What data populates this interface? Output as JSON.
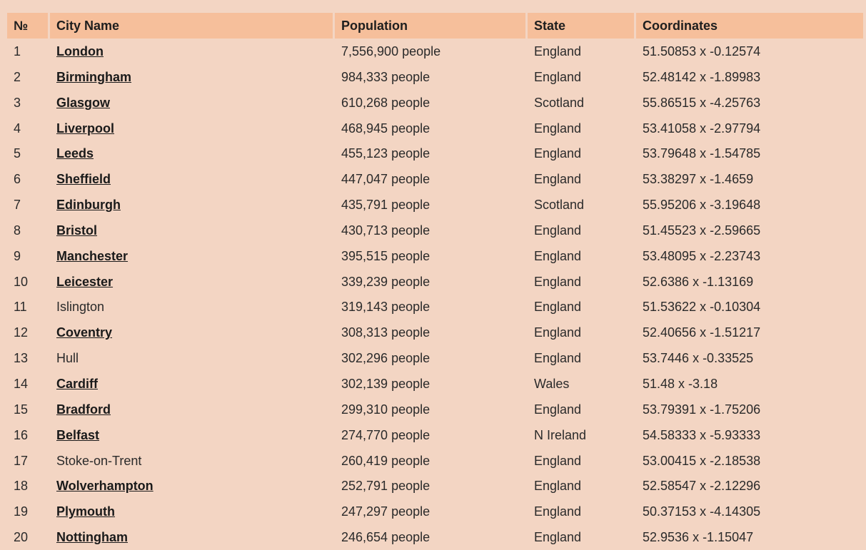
{
  "table": {
    "headers": {
      "num": "№",
      "city": "City Name",
      "population": "Population",
      "state": "State",
      "coordinates": "Coordinates"
    },
    "rows": [
      {
        "num": "1",
        "city": "London",
        "link": true,
        "population": "7,556,900 people",
        "state": "England",
        "coordinates": "51.50853 x -0.12574"
      },
      {
        "num": "2",
        "city": "Birmingham",
        "link": true,
        "population": "984,333 people",
        "state": "England",
        "coordinates": "52.48142 x -1.89983"
      },
      {
        "num": "3",
        "city": "Glasgow",
        "link": true,
        "population": "610,268 people",
        "state": "Scotland",
        "coordinates": "55.86515 x -4.25763"
      },
      {
        "num": "4",
        "city": "Liverpool",
        "link": true,
        "population": "468,945 people",
        "state": "England",
        "coordinates": "53.41058 x -2.97794"
      },
      {
        "num": "5",
        "city": "Leeds",
        "link": true,
        "population": "455,123 people",
        "state": "England",
        "coordinates": "53.79648 x -1.54785"
      },
      {
        "num": "6",
        "city": "Sheffield",
        "link": true,
        "population": "447,047 people",
        "state": "England",
        "coordinates": "53.38297 x -1.4659"
      },
      {
        "num": "7",
        "city": "Edinburgh",
        "link": true,
        "population": "435,791 people",
        "state": "Scotland",
        "coordinates": "55.95206 x -3.19648"
      },
      {
        "num": "8",
        "city": "Bristol",
        "link": true,
        "population": "430,713 people",
        "state": "England",
        "coordinates": "51.45523 x -2.59665"
      },
      {
        "num": "9",
        "city": "Manchester",
        "link": true,
        "population": "395,515 people",
        "state": "England",
        "coordinates": "53.48095 x -2.23743"
      },
      {
        "num": "10",
        "city": "Leicester",
        "link": true,
        "population": "339,239 people",
        "state": "England",
        "coordinates": "52.6386 x -1.13169"
      },
      {
        "num": "11",
        "city": "Islington",
        "link": false,
        "population": "319,143 people",
        "state": "England",
        "coordinates": "51.53622 x -0.10304"
      },
      {
        "num": "12",
        "city": "Coventry",
        "link": true,
        "population": "308,313 people",
        "state": "England",
        "coordinates": "52.40656 x -1.51217"
      },
      {
        "num": "13",
        "city": "Hull",
        "link": false,
        "population": "302,296 people",
        "state": "England",
        "coordinates": "53.7446 x -0.33525"
      },
      {
        "num": "14",
        "city": "Cardiff",
        "link": true,
        "population": "302,139 people",
        "state": "Wales",
        "coordinates": "51.48 x -3.18"
      },
      {
        "num": "15",
        "city": "Bradford",
        "link": true,
        "population": "299,310 people",
        "state": "England",
        "coordinates": "53.79391 x -1.75206"
      },
      {
        "num": "16",
        "city": "Belfast",
        "link": true,
        "population": "274,770 people",
        "state": "N Ireland",
        "coordinates": "54.58333 x -5.93333"
      },
      {
        "num": "17",
        "city": "Stoke-on-Trent",
        "link": false,
        "population": "260,419 people",
        "state": "England",
        "coordinates": "53.00415 x -2.18538"
      },
      {
        "num": "18",
        "city": "Wolverhampton",
        "link": true,
        "population": "252,791 people",
        "state": "England",
        "coordinates": "52.58547 x -2.12296"
      },
      {
        "num": "19",
        "city": "Plymouth",
        "link": true,
        "population": "247,297 people",
        "state": "England",
        "coordinates": "50.37153 x -4.14305"
      },
      {
        "num": "20",
        "city": "Nottingham",
        "link": true,
        "population": "246,654 people",
        "state": "England",
        "coordinates": "52.9536 x -1.15047"
      }
    ]
  },
  "colors": {
    "page_background": "#f3d5c3",
    "header_background": "#f6bf9b",
    "text": "#2a2a2a"
  }
}
